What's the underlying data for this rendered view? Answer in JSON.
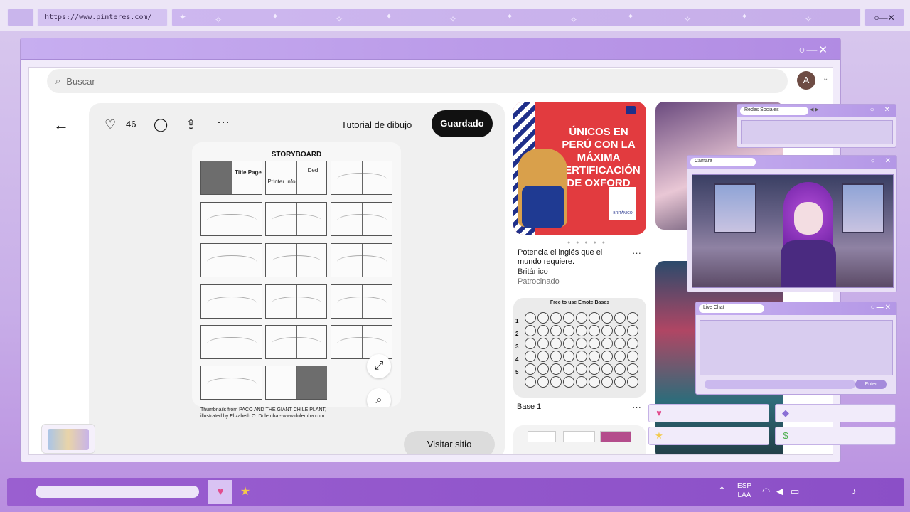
{
  "browser": {
    "url": "https://www.pinteres.com/",
    "window_controls": "○—✕",
    "frame_controls": "○—✕"
  },
  "header": {
    "search_placeholder": "Buscar",
    "avatar_initial": "A"
  },
  "pin": {
    "like_count": "46",
    "board_name": "Tutorial de dibujo",
    "saved_label": "Guardado",
    "visit_label": "Visitar sitio",
    "image": {
      "title": "STORYBOARD",
      "cell_title": "Title Page",
      "cell_printer": "Printer Info",
      "cell_ded": "Ded",
      "credit_line1": "Thumbnails from PACO AND THE GIANT CHILE PLANT,",
      "credit_line2": "illustrated by Elizabeth O. Dulemba - www.dulemba.com"
    }
  },
  "feed": {
    "ad": {
      "headline": "ÚNICOS EN PERÚ CON LA MÁXIMA CERTIFICACIÓN DE OXFORD",
      "badge": "BRITÁNICO",
      "caption": "Potencia el inglés que el mundo requiere.",
      "brand": "Británico",
      "promoted": "Patrocinado",
      "more": "···"
    },
    "emote": {
      "title": "Free to use Emote Bases",
      "row_numbers": [
        "1",
        "2",
        "3",
        "4",
        "5"
      ],
      "caption": "Base 1",
      "more": "···"
    }
  },
  "overlays": {
    "social": {
      "name": "Redes Sociales",
      "controls": "○—✕"
    },
    "camera": {
      "name": "Camara",
      "controls": "○—✕"
    },
    "chat": {
      "name": "Live Chat",
      "controls": "○—✕",
      "enter_label": "Enter"
    }
  },
  "taskbar": {
    "lang_line1": "ESP",
    "lang_line2": "LAA"
  },
  "colors": {
    "accent": "#9a5fd0",
    "pin_saved": "#111111",
    "ad_red": "#e23b3f"
  }
}
